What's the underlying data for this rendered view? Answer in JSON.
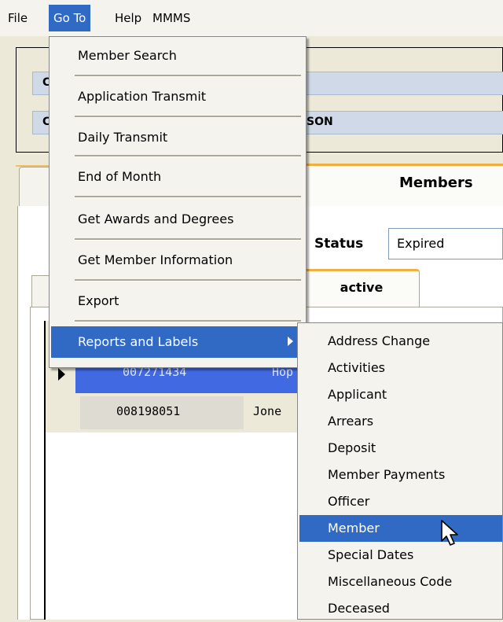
{
  "menubar": {
    "items": [
      "File",
      "Go To",
      "Help",
      "MMMS"
    ]
  },
  "form": {
    "header_field_1": "C",
    "header_field_2": "C",
    "header_field_2_value": "SON",
    "members_tab_title": "Members",
    "status_label": "Status",
    "status_value": "Expired",
    "inactive_tab_label": "active"
  },
  "grid": {
    "rows": [
      {
        "id": "007271434",
        "name": "Hop"
      },
      {
        "id": "008198051",
        "name": "Jone"
      }
    ]
  },
  "goto_menu": {
    "items": [
      "Member Search",
      "Application Transmit",
      "Daily Transmit",
      "End of Month",
      "Get Awards and Degrees",
      "Get Member Information",
      "Export",
      "Reports and Labels"
    ],
    "highlighted": "Reports and Labels"
  },
  "reports_submenu": {
    "items": [
      "Address Change",
      "Activities",
      "Applicant",
      "Arrears",
      "Deposit",
      "Member Payments",
      "Officer",
      "Member",
      "Special Dates",
      "Miscellaneous Code",
      "Deceased"
    ],
    "highlighted": "Member"
  },
  "colors": {
    "highlight": "#316ac5",
    "selected_row": "#4169e1",
    "tab_accent": "#f0b040"
  }
}
